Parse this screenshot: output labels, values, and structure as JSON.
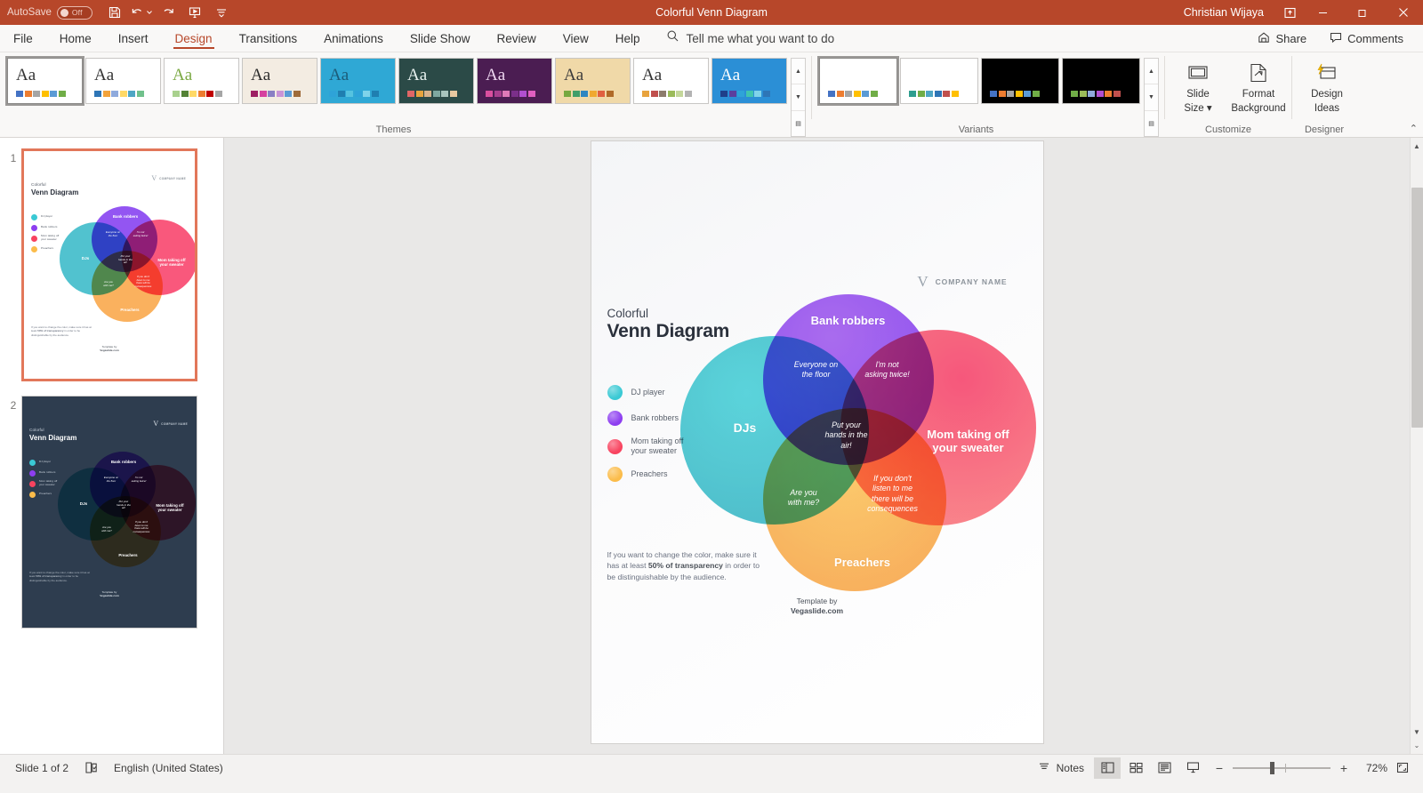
{
  "titlebar": {
    "autosave_label": "AutoSave",
    "autosave_state": "Off",
    "document_title": "Colorful Venn Diagram",
    "user_name": "Christian Wijaya",
    "icons": {
      "save": "save-icon",
      "undo": "undo-icon",
      "redo": "redo-icon",
      "present": "start-presentation-icon",
      "customize_qat": "customize-quick-access-toolbar-icon",
      "ribbon_display": "ribbon-display-options-icon",
      "minimize": "minimize-icon",
      "restore": "restore-icon",
      "close": "close-icon"
    }
  },
  "ribbon_tabs": [
    {
      "label": "File",
      "active": false
    },
    {
      "label": "Home",
      "active": false
    },
    {
      "label": "Insert",
      "active": false
    },
    {
      "label": "Design",
      "active": true
    },
    {
      "label": "Transitions",
      "active": false
    },
    {
      "label": "Animations",
      "active": false
    },
    {
      "label": "Slide Show",
      "active": false
    },
    {
      "label": "Review",
      "active": false
    },
    {
      "label": "View",
      "active": false
    },
    {
      "label": "Help",
      "active": false
    }
  ],
  "tellme": {
    "placeholder": "Tell me what you want to do"
  },
  "menubar_right": {
    "share_label": "Share",
    "comments_label": "Comments"
  },
  "ribbon": {
    "groups": {
      "themes_label": "Themes",
      "variants_label": "Variants",
      "customize_label": "Customize",
      "designer_label": "Designer"
    },
    "themes": [
      {
        "name": "office-theme",
        "selected": true,
        "bg": "#ffffff",
        "aa_color": "#333333",
        "swatches": [
          "#4472c4",
          "#ed7d31",
          "#a5a5a5",
          "#ffc000",
          "#5b9bd5",
          "#70ad47"
        ]
      },
      {
        "name": "facet-theme",
        "selected": false,
        "bg": "#ffffff",
        "aa_color": "#333333",
        "swatches": [
          "#2e75b6",
          "#f2a33c",
          "#8faadc",
          "#ffd966",
          "#4ea6c4",
          "#70c18c"
        ]
      },
      {
        "name": "green-accent-theme",
        "selected": false,
        "bg": "#ffffff",
        "aa_color": "#7ba943",
        "swatches": [
          "#a9d18e",
          "#548235",
          "#ffd966",
          "#ed7d31",
          "#c00000",
          "#a6a6a6"
        ]
      },
      {
        "name": "wood-type-theme",
        "selected": false,
        "bg": "#f3ece2",
        "aa_color": "#2b2b2b",
        "swatches": [
          "#9e1f63",
          "#d6409f",
          "#8a7fc4",
          "#c994d6",
          "#5b9bd5",
          "#9e6b3a"
        ]
      },
      {
        "name": "damask-theme",
        "selected": false,
        "bg": "#2fa8d5",
        "aa_color": "#1c5b78",
        "swatches": [
          "#2ea3d8",
          "#1f7fb0",
          "#55c3e0",
          "#2ea3d8",
          "#7fd3ea",
          "#1f7fb0"
        ]
      },
      {
        "name": "ion-boardroom-green-theme",
        "selected": false,
        "bg": "#2b4a47",
        "aa_color": "#e8f2f0",
        "swatches": [
          "#e06666",
          "#e8a33d",
          "#d9b38c",
          "#7fa8a0",
          "#a9c4bd",
          "#e8c8a0"
        ]
      },
      {
        "name": "berlin-purple-theme",
        "selected": false,
        "bg": "#4b1d52",
        "aa_color": "#f0d8f2",
        "swatches": [
          "#d94f9e",
          "#a83f8e",
          "#e07ab8",
          "#7b2f8a",
          "#b14fd0",
          "#e05fc0"
        ]
      },
      {
        "name": "banded-tan-theme",
        "selected": false,
        "bg": "#f0d9a8",
        "aa_color": "#3b3b3b",
        "swatches": [
          "#76a840",
          "#3f9e6a",
          "#2e86c1",
          "#f0a830",
          "#e06040",
          "#b06a28"
        ]
      },
      {
        "name": "basis-white-theme",
        "selected": false,
        "bg": "#ffffff",
        "aa_color": "#333333",
        "swatches": [
          "#e8a33d",
          "#c0504d",
          "#8c7b6b",
          "#9bbb59",
          "#c4d79b",
          "#b3b3b3"
        ]
      },
      {
        "name": "celestial-blue-theme",
        "selected": false,
        "bg": "#2b8fd6",
        "aa_color": "#ffffff",
        "swatches": [
          "#1f3f8a",
          "#5b3f9e",
          "#2ea3d8",
          "#40c4b0",
          "#7fd3ea",
          "#2e75b6"
        ]
      }
    ],
    "variants": [
      {
        "name": "variant-light-1",
        "selected": true,
        "dark": false,
        "swatches": [
          "#4472c4",
          "#ed7d31",
          "#a5a5a5",
          "#ffc000",
          "#5b9bd5",
          "#70ad47"
        ]
      },
      {
        "name": "variant-light-2",
        "selected": false,
        "dark": false,
        "swatches": [
          "#2e9e8f",
          "#70ad47",
          "#4ea6c4",
          "#2e75b6",
          "#c0504d",
          "#ffc000"
        ]
      },
      {
        "name": "variant-dark-1",
        "selected": false,
        "dark": true,
        "swatches": [
          "#4472c4",
          "#ed7d31",
          "#a5a5a5",
          "#ffc000",
          "#5b9bd5",
          "#70ad47"
        ]
      },
      {
        "name": "variant-dark-2",
        "selected": false,
        "dark": true,
        "swatches": [
          "#70ad47",
          "#9bbb59",
          "#8faadc",
          "#b14fd0",
          "#ed7d31",
          "#c0504d"
        ]
      }
    ],
    "buttons": {
      "slide_size_l1": "Slide",
      "slide_size_l2": "Size",
      "format_background_l1": "Format",
      "format_background_l2": "Background",
      "design_ideas_l1": "Design",
      "design_ideas_l2": "Ideas"
    }
  },
  "thumbnails": [
    {
      "number": "1",
      "active": true,
      "dark": false
    },
    {
      "number": "2",
      "active": false,
      "dark": true
    }
  ],
  "slide": {
    "company_mark": "V",
    "company_name": "COMPANY NAME",
    "kicker": "Colorful",
    "title": "Venn Diagram",
    "legend": [
      {
        "label": "DJ player",
        "color": "#3ac9d4"
      },
      {
        "label": "Bank robbers",
        "color": "#8d3ef0"
      },
      {
        "label": "Mom taking off\nyour sweater",
        "color": "#f8435f"
      },
      {
        "label": "Preachers",
        "color": "#fbbc4a"
      }
    ],
    "circles": {
      "dj": {
        "label": "DJs",
        "color": "#2ab5c4"
      },
      "bank": {
        "label": "Bank robbers",
        "color": "#7b2ff0"
      },
      "mom": {
        "label": "Mom taking off\nyour sweater",
        "color": "#f8335f"
      },
      "preach": {
        "label": "Preachers",
        "color": "#f9a03a"
      }
    },
    "intersections": {
      "dj_bank": "Everyone on\nthe floor",
      "bank_mom": "I'm not\nasking twice!",
      "triple_top": "Put your\nhands in the\nair!",
      "dj_preach": "Are you\nwith me?",
      "preach_mom": "If you don't\nlisten to me\nthere will be\nconsequences"
    },
    "note_part1": "If you want to change the color, make sure it has at least ",
    "note_bold": "50% of transparency",
    "note_part2": " in order to be distinguishable by the audience.",
    "credit_line1": "Template by",
    "credit_line2": "Vegaslide.com"
  },
  "statusbar": {
    "slide_counter": "Slide 1 of 2",
    "language": "English (United States)",
    "notes_label": "Notes",
    "zoom_percent": "72%",
    "icons": {
      "accessibility": "accessibility-checker-icon",
      "notes": "notes-icon",
      "normal_view": "normal-view-icon",
      "slide_sorter": "slide-sorter-view-icon",
      "reading_view": "reading-view-icon",
      "slideshow": "slideshow-view-icon",
      "zoom_out": "zoom-out-icon",
      "zoom_in": "zoom-in-icon",
      "fit_slide": "fit-slide-to-window-icon"
    }
  },
  "colors": {
    "accent": "#b7472a",
    "teal": "#2ab5c4",
    "purple": "#7b2ff0",
    "red": "#f8335f",
    "orange": "#f9a03a"
  }
}
